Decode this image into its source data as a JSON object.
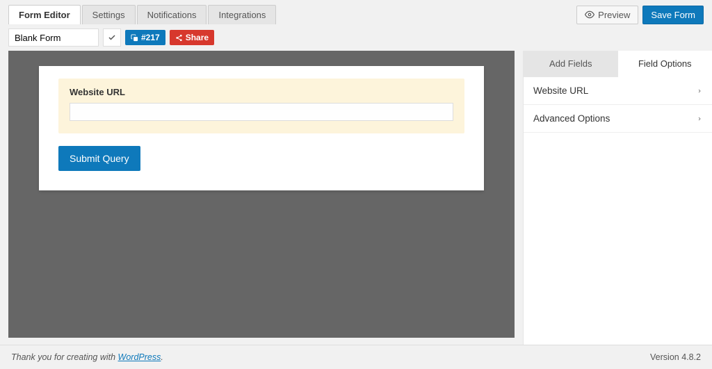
{
  "tabs": [
    "Form Editor",
    "Settings",
    "Notifications",
    "Integrations"
  ],
  "activeTabIndex": 0,
  "top": {
    "preview": "Preview",
    "save": "Save Form"
  },
  "form": {
    "title": "Blank Form",
    "idBadge": "#217",
    "shareLabel": "Share"
  },
  "field": {
    "label": "Website URL",
    "value": ""
  },
  "submit": "Submit Query",
  "sidebar": {
    "tabs": [
      "Add Fields",
      "Field Options"
    ],
    "activeTabIndex": 1,
    "panels": [
      "Website URL",
      "Advanced Options"
    ]
  },
  "footer": {
    "prefix": "Thank you for creating with ",
    "linkText": "WordPress",
    "suffix": ".",
    "version": "Version 4.8.2"
  }
}
